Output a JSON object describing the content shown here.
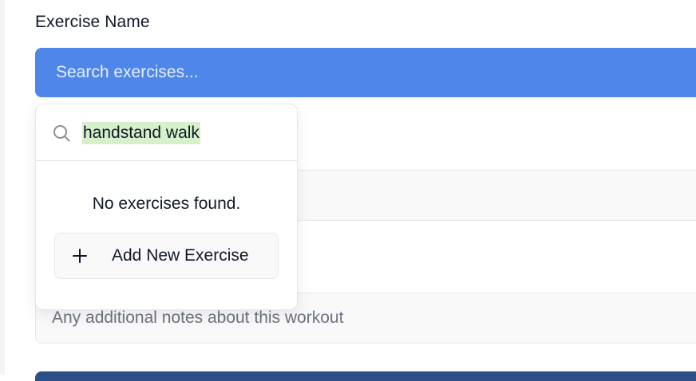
{
  "form": {
    "exercise_label": "Exercise Name",
    "exercise_trigger_placeholder": "Search exercises...",
    "notes_placeholder": "Any additional notes about this workout"
  },
  "dropdown": {
    "search_value": "handstand walk",
    "empty_message": "No exercises found.",
    "add_button_label": "Add New Exercise"
  },
  "icons": {
    "search": "search-icon",
    "add": "plus-icon"
  },
  "colors": {
    "primary": "#4f86ea",
    "highlight": "#d6f0c9"
  }
}
